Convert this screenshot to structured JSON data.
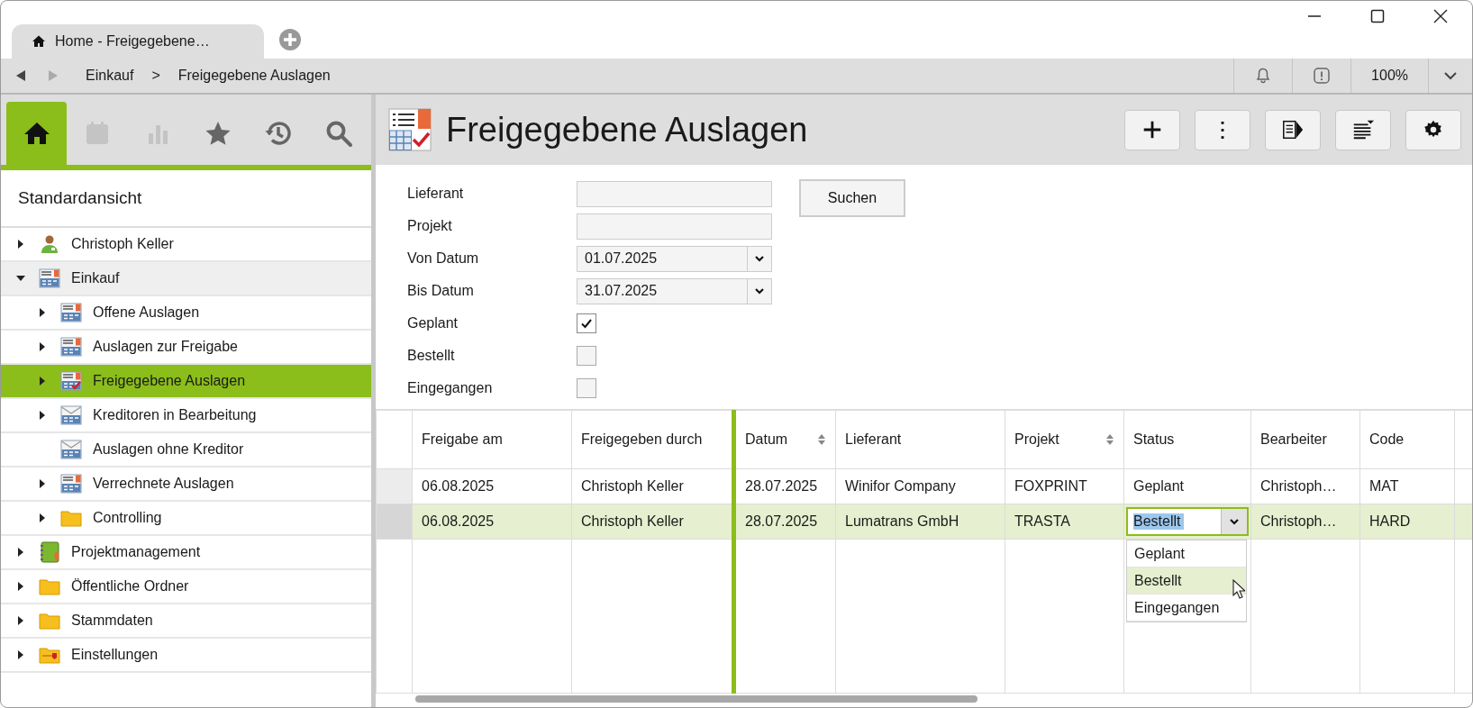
{
  "window": {
    "tab_title": "Home - Freigegebene…"
  },
  "nav": {
    "breadcrumb": [
      "Einkauf",
      ">",
      "Freigegebene Auslagen"
    ],
    "zoom": "100%"
  },
  "sidebar": {
    "tabs": [
      {
        "kind": "home",
        "selected": true,
        "disabled": false
      },
      {
        "kind": "calendar",
        "selected": false,
        "disabled": true
      },
      {
        "kind": "chart",
        "selected": false,
        "disabled": true
      },
      {
        "kind": "star",
        "selected": false,
        "disabled": false
      },
      {
        "kind": "history",
        "selected": false,
        "disabled": false
      },
      {
        "kind": "search",
        "selected": false,
        "disabled": false
      }
    ],
    "view_title": "Standardansicht",
    "tree": [
      {
        "label": "Christoph Keller",
        "kind": "person",
        "expandable": true,
        "expanded": false,
        "selected": false,
        "hovered": false
      },
      {
        "label": "Einkauf",
        "kind": "list",
        "expandable": true,
        "expanded": true,
        "selected": false,
        "hovered": true,
        "children": [
          {
            "label": "Offene Auslagen",
            "kind": "list",
            "expandable": true,
            "expanded": false,
            "selected": false,
            "hovered": false
          },
          {
            "label": "Auslagen zur Freigabe",
            "kind": "list",
            "expandable": true,
            "expanded": false,
            "selected": false,
            "hovered": false
          },
          {
            "label": "Freigegebene Auslagen",
            "kind": "list-check",
            "expandable": true,
            "expanded": false,
            "selected": true,
            "hovered": false
          },
          {
            "label": "Kreditoren in Bearbeitung",
            "kind": "mail-list",
            "expandable": true,
            "expanded": false,
            "selected": false,
            "hovered": false
          },
          {
            "label": "Auslagen ohne Kreditor",
            "kind": "mail-list",
            "expandable": false,
            "expanded": false,
            "selected": false,
            "hovered": false
          },
          {
            "label": "Verrechnete Auslagen",
            "kind": "list",
            "expandable": true,
            "expanded": false,
            "selected": false,
            "hovered": false
          },
          {
            "label": "Controlling",
            "kind": "folder",
            "expandable": true,
            "expanded": false,
            "selected": false,
            "hovered": false
          }
        ]
      },
      {
        "label": "Projektmanagement",
        "kind": "notebook",
        "expandable": true,
        "expanded": false,
        "selected": false,
        "hovered": false
      },
      {
        "label": "Öffentliche Ordner",
        "kind": "folder",
        "expandable": true,
        "expanded": false,
        "selected": false,
        "hovered": false
      },
      {
        "label": "Stammdaten",
        "kind": "folder",
        "expandable": true,
        "expanded": false,
        "selected": false,
        "hovered": false
      },
      {
        "label": "Einstellungen",
        "kind": "settings-folder",
        "expandable": true,
        "expanded": false,
        "selected": false,
        "hovered": false
      }
    ]
  },
  "page": {
    "title": "Freigegebene Auslagen",
    "toolbar": [
      {
        "kind": "add"
      },
      {
        "kind": "more"
      },
      {
        "kind": "panel"
      },
      {
        "kind": "sort"
      },
      {
        "kind": "settings"
      }
    ],
    "filters": [
      {
        "label": "Lieferant",
        "kind": "text"
      },
      {
        "label": "Projekt",
        "kind": "text"
      },
      {
        "label": "Von Datum",
        "kind": "date",
        "value": "01.07.2025"
      },
      {
        "label": "Bis Datum",
        "kind": "date",
        "value": "31.07.2025"
      },
      {
        "label": "Geplant",
        "kind": "checkbox",
        "checked": true
      },
      {
        "label": "Bestellt",
        "kind": "checkbox",
        "checked": false
      },
      {
        "label": "Eingegangen",
        "kind": "checkbox",
        "checked": false
      }
    ],
    "search_button": "Suchen"
  },
  "table": {
    "columns": [
      {
        "label": "Freigabe am",
        "sortable": false,
        "pinned": true
      },
      {
        "label": "Freigegeben durch",
        "sortable": false,
        "pinned": true
      },
      {
        "label": "Datum",
        "sortable": true,
        "pinned": false
      },
      {
        "label": "Lieferant",
        "sortable": false,
        "pinned": false
      },
      {
        "label": "Projekt",
        "sortable": true,
        "pinned": false
      },
      {
        "label": "Status",
        "sortable": false,
        "pinned": false
      },
      {
        "label": "Bearbeiter",
        "sortable": false,
        "pinned": false
      },
      {
        "label": "Code",
        "sortable": false,
        "pinned": false
      }
    ],
    "rows": [
      {
        "selected": false,
        "cells": [
          {
            "kind": "text",
            "text": "06.08.2025"
          },
          {
            "kind": "text",
            "text": "Christoph Keller"
          },
          {
            "kind": "text",
            "text": "28.07.2025"
          },
          {
            "kind": "text",
            "text": "Winifor Company"
          },
          {
            "kind": "text",
            "text": "FOXPRINT"
          },
          {
            "kind": "text",
            "text": "Geplant"
          },
          {
            "kind": "text",
            "text": "Christoph…"
          },
          {
            "kind": "text",
            "text": "MAT"
          }
        ]
      },
      {
        "selected": true,
        "cells": [
          {
            "kind": "text",
            "text": "06.08.2025"
          },
          {
            "kind": "text",
            "text": "Christoph Keller"
          },
          {
            "kind": "text",
            "text": "28.07.2025"
          },
          {
            "kind": "text",
            "text": "Lumatrans GmbH"
          },
          {
            "kind": "text",
            "text": "TRASTA"
          },
          {
            "kind": "dropdown",
            "text": "Bestellt",
            "options": [
              {
                "label": "Geplant",
                "selected": false
              },
              {
                "label": "Bestellt",
                "selected": true
              },
              {
                "label": "Eingegangen",
                "selected": false
              }
            ]
          },
          {
            "kind": "text",
            "text": "Christoph…"
          },
          {
            "kind": "text",
            "text": "HARD"
          }
        ]
      }
    ]
  }
}
